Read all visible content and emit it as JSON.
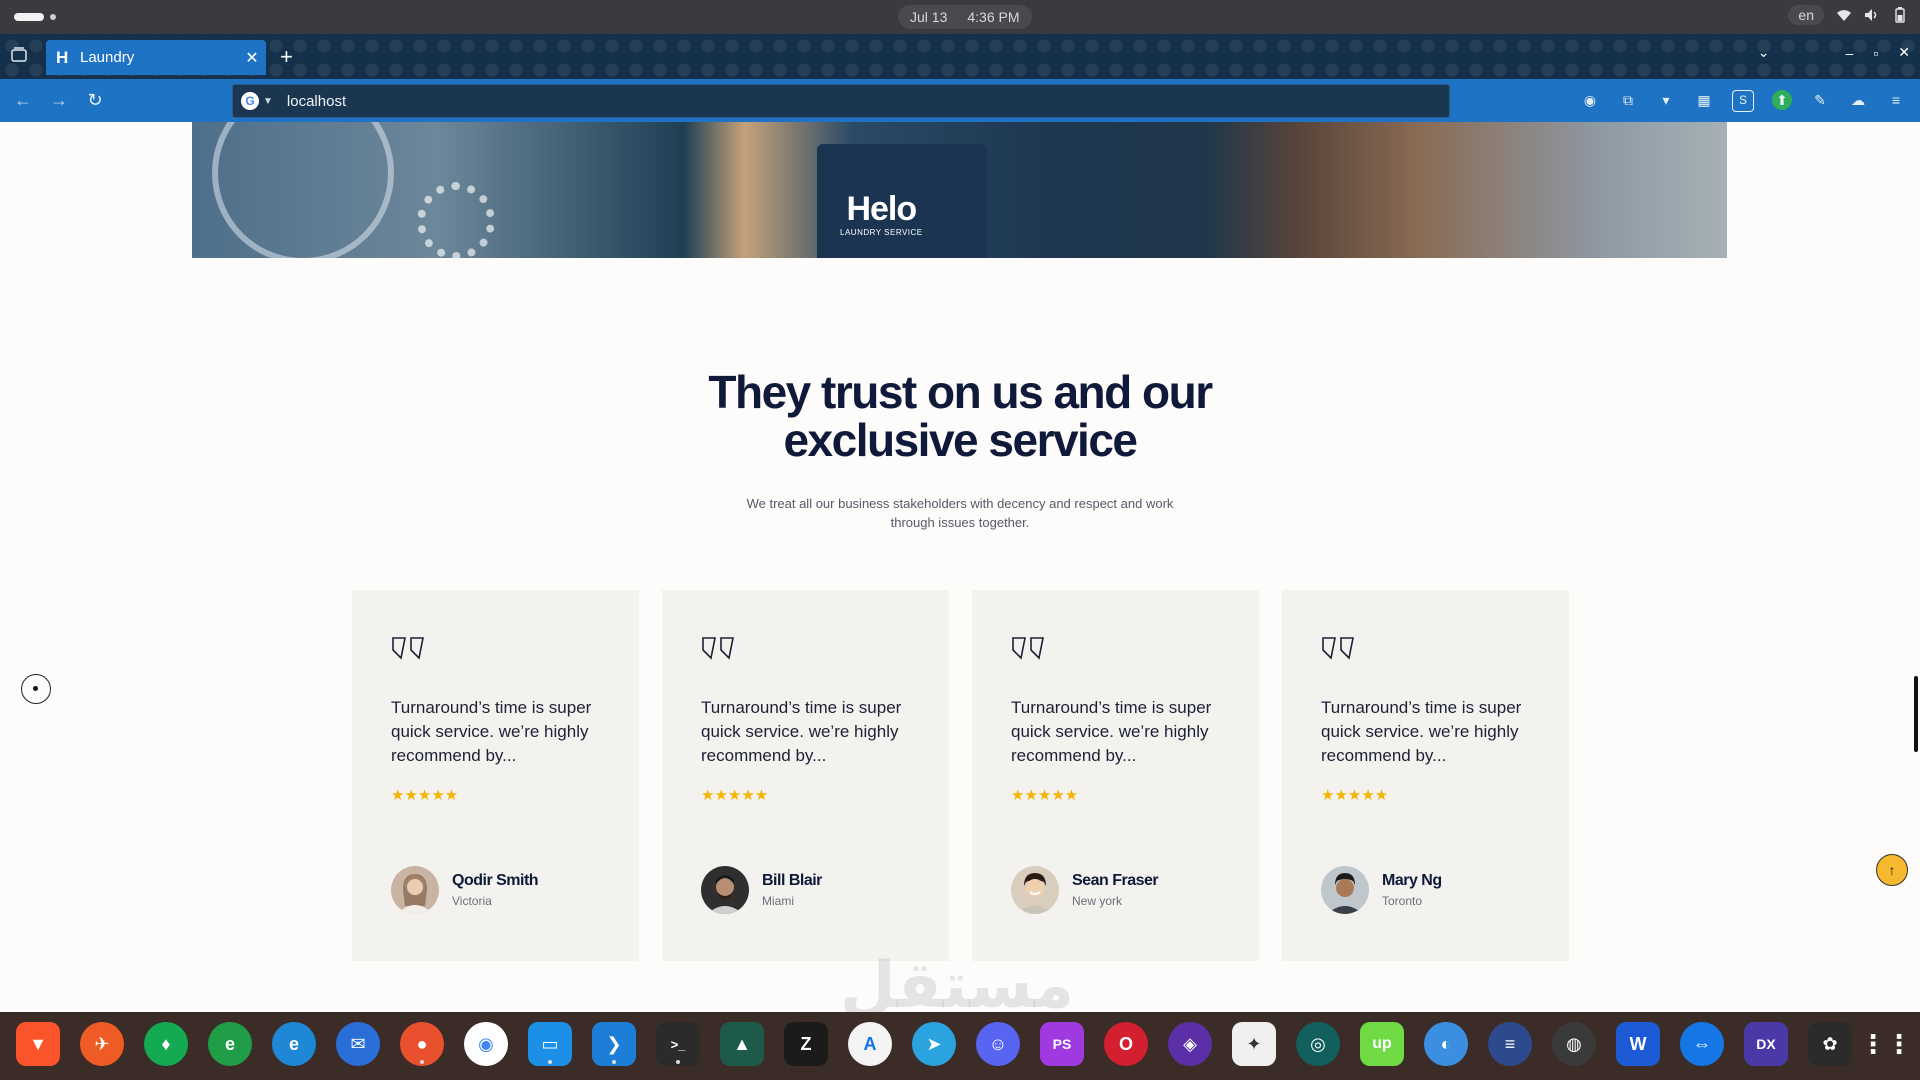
{
  "os": {
    "date": "Jul 13",
    "time": "4:36 PM",
    "language": "en",
    "icons": [
      "wifi-icon",
      "volume-icon",
      "battery-icon"
    ]
  },
  "browser": {
    "tab_title": "Laundry",
    "tab_favicon": "H",
    "new_tab": "+",
    "url": "localhost",
    "icons": [
      "back-icon",
      "forward-icon",
      "reload-icon",
      "google-icon"
    ],
    "extensions": [
      "account-icon",
      "extensions-icon",
      "vpn-icon",
      "grid-icon",
      "s-icon",
      "shield-icon",
      "pen-icon",
      "cloud-icon",
      "menu-icon"
    ]
  },
  "hero": {
    "logo": "Helo",
    "logo_sub": "LAUNDRY SERVICE"
  },
  "testimonials": {
    "title_line1": "They trust on us and our",
    "title_line2": "exclusive service",
    "subtitle": "We treat all our business stakeholders with decency and respect and work through issues together.",
    "rating": 5,
    "items": [
      {
        "text": "Turnaround’s time is super quick service. we’re highly recommend by...",
        "stars": "★★★★★",
        "name": "Qodir Smith",
        "city": "Victoria"
      },
      {
        "text": "Turnaround’s time is super quick service. we’re highly recommend by...",
        "stars": "★★★★★",
        "name": "Bill Blair",
        "city": "Miami"
      },
      {
        "text": "Turnaround’s time is super quick service. we’re highly recommend by...",
        "stars": "★★★★★",
        "name": "Sean Fraser",
        "city": "New york"
      },
      {
        "text": "Turnaround’s time is super quick service. we’re highly recommend by...",
        "stars": "★★★★★",
        "name": "Mary Ng",
        "city": "Toronto"
      }
    ]
  },
  "watermark": "مستقل",
  "dock": {
    "apps": [
      "brave-icon",
      "postman-icon",
      "mongodb-icon",
      "edge-dev-icon",
      "edge-icon",
      "thunderbird-icon",
      "firefox-icon",
      "chrome-icon",
      "files-icon",
      "vscode-icon",
      "terminal-icon",
      "monitor-icon",
      "zed-icon",
      "inkscape-icon",
      "telegram-icon",
      "discord-icon",
      "phpstorm-icon",
      "opera-icon",
      "proton-icon",
      "gimp-icon",
      "gitkraken-icon",
      "upwork-icon",
      "vpn-client-icon",
      "toggle-icon",
      "obs-icon",
      "wps-writer-icon",
      "teamviewer-icon",
      "azure-data-studio-icon",
      "figma-icon",
      "app-grid-icon"
    ],
    "accent_colors": {
      "brand_blue": "#1f73c4",
      "star": "#f5b400",
      "heading": "#0f1a3a"
    }
  }
}
